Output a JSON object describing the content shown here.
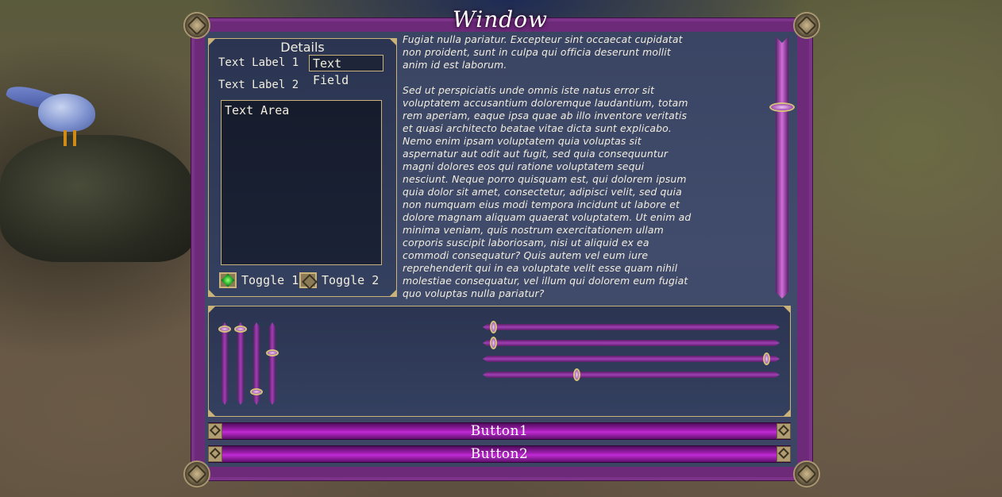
{
  "window": {
    "title": "Window"
  },
  "details": {
    "title": "Details",
    "label1": "Text Label 1",
    "label2": "Text Label 2",
    "text_field_value": "Text Field",
    "text_area_value": "Text Area",
    "toggle1": {
      "label": "Toggle 1",
      "checked": true
    },
    "toggle2": {
      "label": "Toggle 2",
      "checked": false
    }
  },
  "content": {
    "text": "Fugiat nulla pariatur. Excepteur sint occaecat cupidatat\nnon proident, sunt in culpa qui officia deserunt mollit\nanim id est laborum.\n\nSed ut perspiciatis unde omnis iste natus error sit\nvoluptatem accusantium doloremque laudantium, totam\nrem aperiam, eaque ipsa quae ab illo inventore veritatis\net quasi architecto beatae vitae dicta sunt explicabo.\nNemo enim ipsam voluptatem quia voluptas sit\naspernatur aut odit aut fugit, sed quia consequuntur\nmagni dolores eos qui ratione voluptatem sequi\nnesciunt. Neque porro quisquam est, qui dolorem ipsum\nquia dolor sit amet, consectetur, adipisci velit, sed quia\nnon numquam eius modi tempora incidunt ut labore et\ndolore magnam aliquam quaerat voluptatem. Ut enim ad\nminima veniam, quis nostrum exercitationem ullam\ncorporis suscipit laboriosam, nisi ut aliquid ex ea\ncommodi consequatur? Quis autem vel eum iure\nreprehenderit qui in ea voluptate velit esse quam nihil\nmolestiae consequatur, vel illum qui dolorem eum fugiat\nquo voluptas nulla pariatur?",
    "scroll_position": 0.25
  },
  "sliders": {
    "vertical_values": [
      0.0,
      0.0,
      0.9,
      0.35
    ],
    "horizontal_values": [
      0.02,
      0.02,
      0.97,
      0.31
    ]
  },
  "buttons": {
    "button1": "Button1",
    "button2": "Button2"
  },
  "colors": {
    "frame_purple": "#6c2a78",
    "panel_gold": "#c9b37a",
    "button_magenta": "#a41fb6"
  }
}
